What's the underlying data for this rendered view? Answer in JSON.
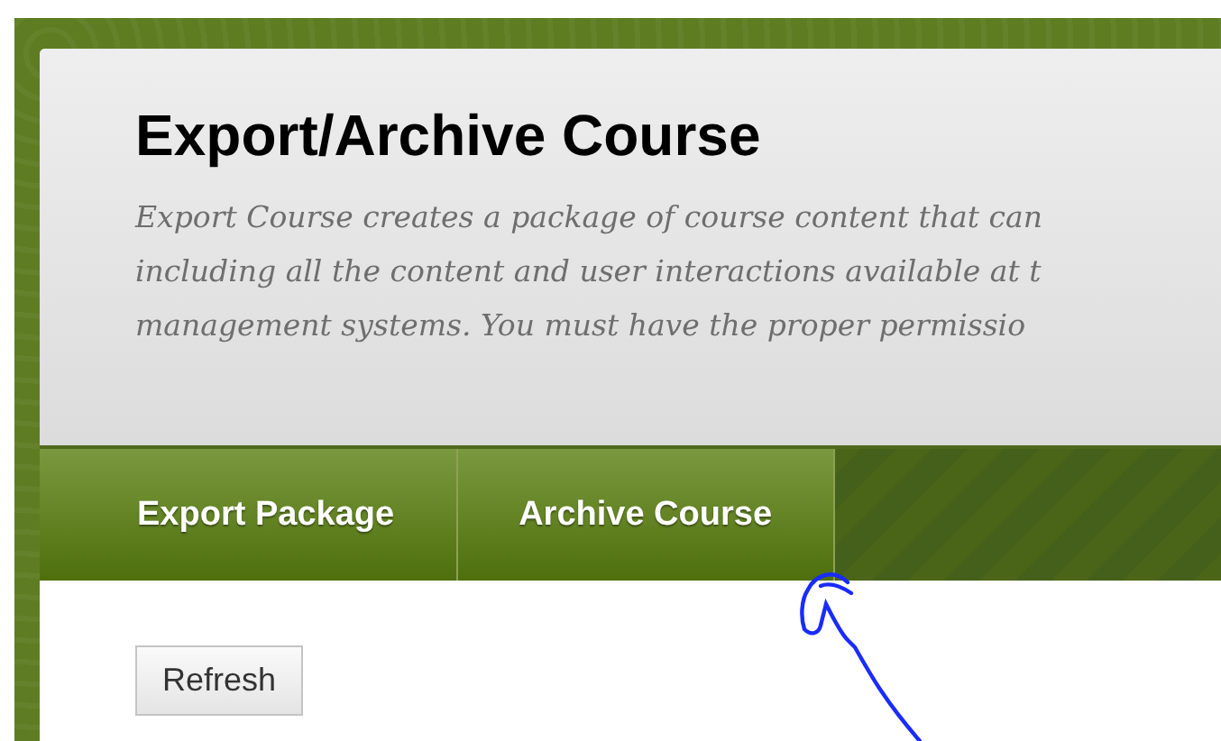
{
  "header": {
    "title": "Export/Archive Course",
    "description_lines": [
      "Export Course creates a package of course content that can",
      "including all the content and user interactions available at t",
      "management systems. You must have the proper permissio"
    ]
  },
  "tabs": [
    {
      "label": "Export Package",
      "selected": false
    },
    {
      "label": "Archive Course",
      "selected": false
    }
  ],
  "buttons": [
    {
      "label": "Refresh"
    }
  ]
}
